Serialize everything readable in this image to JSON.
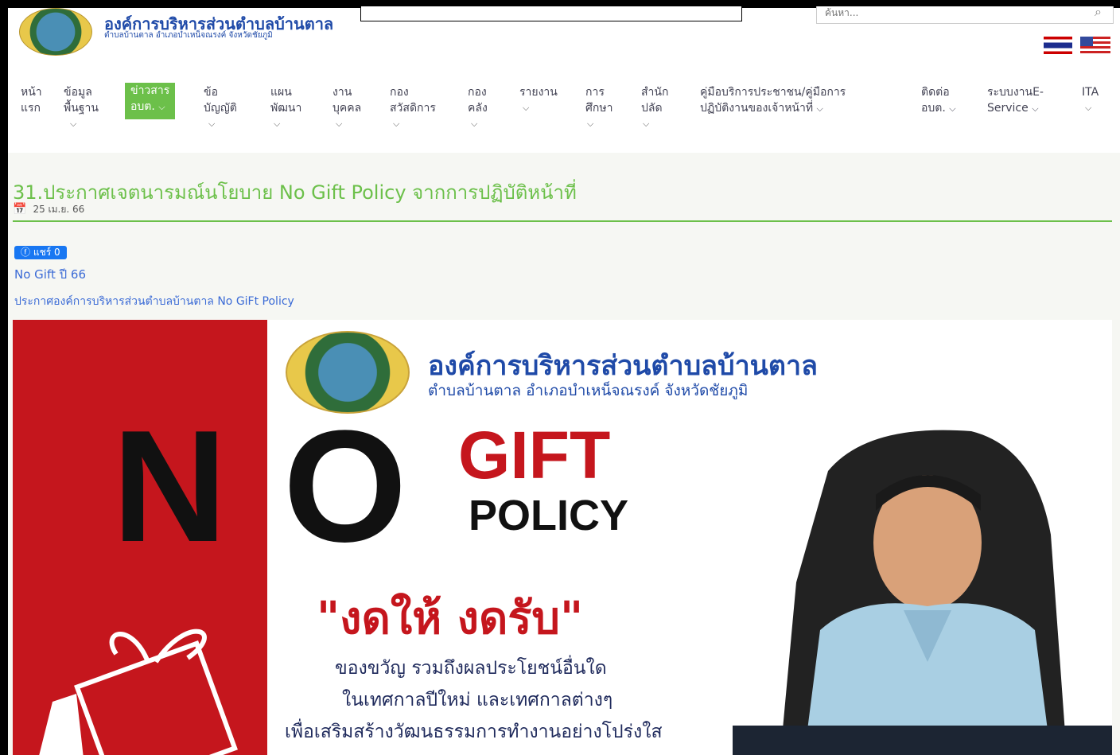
{
  "header": {
    "site_title": "องค์การบริหารส่วนตำบลบ้านตาล",
    "site_subtitle": "ตำบลบ้านตาล อำเภอบำเหน็จณรงค์ จังหวัดชัยภูมิ",
    "search_placeholder": "ค้นหา...",
    "languages": [
      "th-flag",
      "en-flag"
    ]
  },
  "nav": [
    {
      "line1": "หน้า",
      "line2": "แรก",
      "caret": false
    },
    {
      "line1": "ข้อมูล",
      "line2": "พื้นฐาน",
      "caret": true
    },
    {
      "line1": "ข่าวสาร",
      "line2": "อบต.",
      "caret": true,
      "active": true
    },
    {
      "line1": "ข้อ",
      "line2": "บัญญัติ",
      "caret": true
    },
    {
      "line1": "แผน",
      "line2": "พัฒนา",
      "caret": true
    },
    {
      "line1": "งาน",
      "line2": "บุคคล",
      "caret": true
    },
    {
      "line1": "กอง",
      "line2": "สวัสดิการ",
      "caret": true
    },
    {
      "line1": "กอง",
      "line2": "คลัง",
      "caret": true
    },
    {
      "line1": "รายงาน",
      "line2": "",
      "caret": true
    },
    {
      "line1": "การ",
      "line2": "ศึกษา",
      "caret": true
    },
    {
      "line1": "สำนัก",
      "line2": "ปลัด",
      "caret": true
    },
    {
      "line1": "คู่มือบริการประชาชน/คู่มือการ",
      "line2": "ปฏิบัติงานของเจ้าหน้าที่",
      "caret": true
    },
    {
      "line1": "ติดต่อ",
      "line2": "อบต.",
      "caret": true
    },
    {
      "line1": "ระบบงานE-",
      "line2": "Service",
      "caret": true
    },
    {
      "line1": "ITA",
      "line2": "",
      "caret": true
    }
  ],
  "post": {
    "title": "31.ประกาศเจตนารมณ์นโยบาย No Gift Policy จากการปฏิบัติหน้าที่",
    "date": "25 เม.ย. 66",
    "share_label": "แชร์ 0",
    "link1": "No Gift ปี 66",
    "link2": "ประกาศองค์การบริหารส่วนตำบลบ้านตาล No GiFt Policy"
  },
  "banner": {
    "org_name": "องค์การบริหารส่วนตำบลบ้านตาล",
    "org_sub": "ตำบลบ้านตาล อำเภอบำเหน็จณรงค์ จังหวัดชัยภูมิ",
    "big_n": "N",
    "big_o": "O",
    "gift": "GIFT",
    "policy": "POLICY",
    "slogan": "\"งดให้ งดรับ\"",
    "line1": "ของขวัญ รวมถึงผลประโยชน์อื่นใด",
    "line2": "ในเทศกาลปีใหม่ และเทศกาลต่างๆ",
    "line3": "เพื่อเสริมสร้างวัฒนธรรมการทำงานอย่างโปร่งใส"
  },
  "colors": {
    "accent_green": "#6cc04a",
    "brand_blue": "#1f4aa8",
    "banner_red": "#c5161d"
  }
}
